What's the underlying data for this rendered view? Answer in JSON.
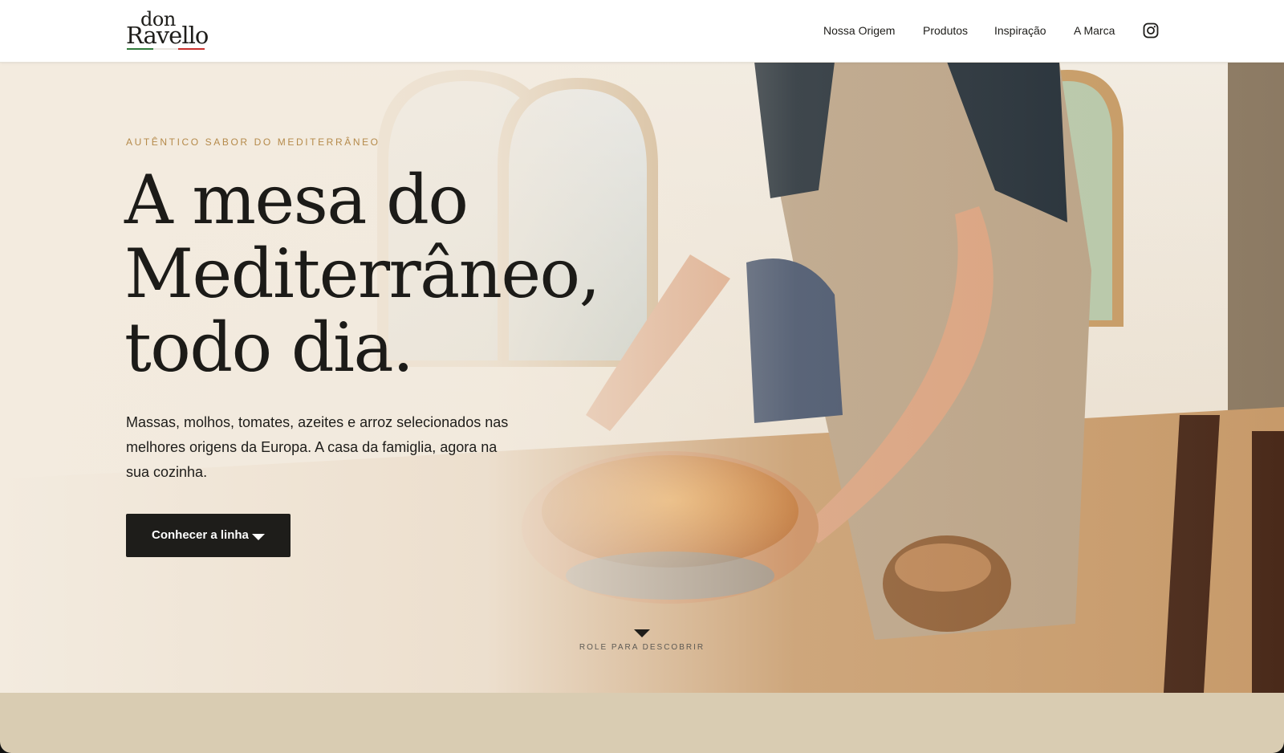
{
  "brand": {
    "logo_top": "don",
    "logo_bottom": "Ravello",
    "colors": {
      "green": "#2f7a3b",
      "red": "#c8302c",
      "ink": "#1e1d1a",
      "gold": "#b58a4a",
      "sand": "#d9ccb2"
    }
  },
  "nav": {
    "items": [
      {
        "label": "Nossa Origem"
      },
      {
        "label": "Produtos"
      },
      {
        "label": "Inspiração"
      },
      {
        "label": "A Marca"
      }
    ],
    "instagram_icon": "instagram-icon"
  },
  "hero": {
    "eyebrow": "AUTÊNTICO SABOR DO MEDITERRÂNEO",
    "headline": [
      "A mesa do",
      "Mediterrâneo,",
      "todo dia."
    ],
    "intro": "Massas, molhos, tomates, azeites e arroz selecionados nas melhores origens da Europa. A casa da famiglia, agora na sua cozinha.",
    "cta_label": "Conhecer a linha",
    "cta_icon": "caret-down-icon",
    "scroll_label": "ROLE PARA DESCOBRIR",
    "scroll_icon": "caret-down-icon"
  }
}
